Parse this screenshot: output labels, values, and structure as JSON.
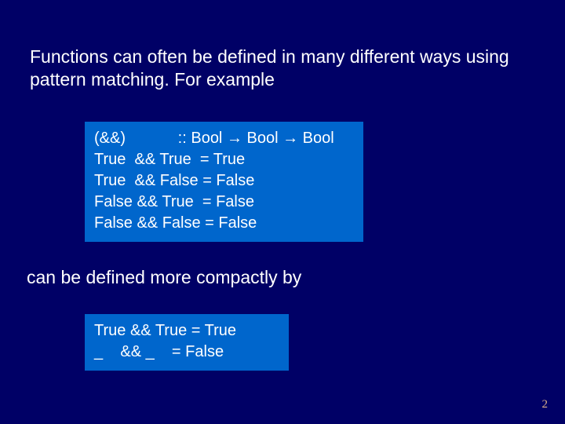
{
  "intro": "Functions can often be defined in many different ways using pattern matching.  For example",
  "code1": {
    "l1a": "(&&)            :: Bool ",
    "l1b": " Bool ",
    "l1c": " Bool",
    "l2": "True  && True  = True",
    "l3": "True  && False = False",
    "l4": "False && True  = False",
    "l5": "False && False = False"
  },
  "middle": "can be defined more compactly by",
  "code2": {
    "l1": "True && True = True",
    "l2": "_    && _    = False"
  },
  "arrow": "→",
  "page": "2"
}
